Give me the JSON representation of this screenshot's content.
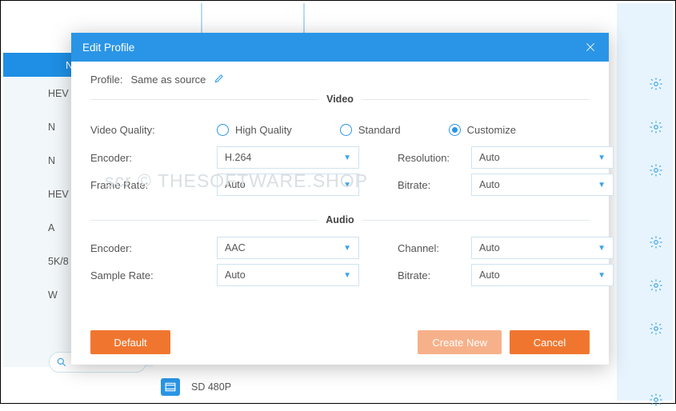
{
  "background": {
    "topstrip_letter": "N",
    "left_items": [
      "HEV",
      "N",
      "N",
      "HEV",
      "A",
      "5K/8",
      "W"
    ],
    "list_label": "SD 480P",
    "gear_positions": [
      92,
      146,
      200,
      290,
      344,
      398,
      492
    ]
  },
  "modal": {
    "title": "Edit Profile",
    "profile_label": "Profile:",
    "profile_value": "Same as source",
    "section_video": "Video",
    "section_audio": "Audio",
    "video_quality_label": "Video Quality:",
    "radio_high": "High Quality",
    "radio_standard": "Standard",
    "radio_customize": "Customize",
    "encoder_label": "Encoder:",
    "framerate_label": "Frame Rate:",
    "resolution_label": "Resolution:",
    "bitrate_label": "Bitrate:",
    "samplerate_label": "Sample Rate:",
    "channel_label": "Channel:",
    "video": {
      "encoder": "H.264",
      "framerate": "Auto",
      "resolution": "Auto",
      "bitrate": "Auto"
    },
    "audio": {
      "encoder": "AAC",
      "samplerate": "Auto",
      "channel": "Auto",
      "bitrate": "Auto"
    },
    "footer": {
      "default": "Default",
      "create_new": "Create New",
      "cancel": "Cancel"
    }
  },
  "watermark": "scr © THESOFTWARE.SHOP"
}
